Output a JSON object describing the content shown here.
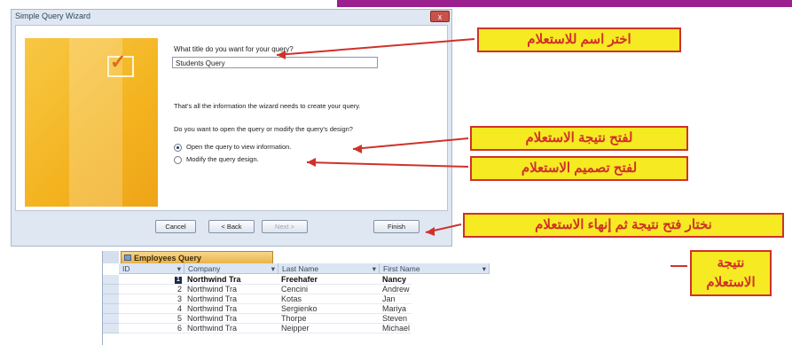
{
  "wizard": {
    "title": "Simple Query Wizard",
    "close": "x",
    "question_title": "What title do you want for your query?",
    "title_value": "Students Query",
    "info_text": "That's all the information the wizard needs to create your query.",
    "question_open": "Do you want to open the query or modify the query's design?",
    "option_open": "Open the query to view information.",
    "option_modify": "Modify the query design.",
    "buttons": {
      "cancel": "Cancel",
      "back": "< Back",
      "next": "Next >",
      "finish": "Finish"
    }
  },
  "callouts": {
    "name_query": "اختر اسم للاستعلام",
    "open_result": "لفتح نتيجة الاستعلام",
    "open_design": "لفتح تصميم الاستعلام",
    "choose_finish": "نختار فتح نتيجة ثم إنهاء الاستعلام",
    "result_line1": "نتيجة",
    "result_line2": "الاستعلام"
  },
  "datasheet": {
    "tab": "Employees Query",
    "columns": [
      "ID",
      "Company",
      "Last Name",
      "First Name"
    ],
    "rows": [
      {
        "id": "1",
        "company": "Northwind Tra",
        "last": "Freehafer",
        "first": "Nancy"
      },
      {
        "id": "2",
        "company": "Northwind Tra",
        "last": "Cencini",
        "first": "Andrew"
      },
      {
        "id": "3",
        "company": "Northwind Tra",
        "last": "Kotas",
        "first": "Jan"
      },
      {
        "id": "4",
        "company": "Northwind Tra",
        "last": "Sergienko",
        "first": "Mariya"
      },
      {
        "id": "5",
        "company": "Northwind Tra",
        "last": "Thorpe",
        "first": "Steven"
      },
      {
        "id": "6",
        "company": "Northwind Tra",
        "last": "Neipper",
        "first": "Michael"
      }
    ]
  },
  "colors": {
    "callout_fill": "#f6ea22",
    "callout_border": "#d0312a",
    "accent_bar": "#9b1f8f"
  }
}
